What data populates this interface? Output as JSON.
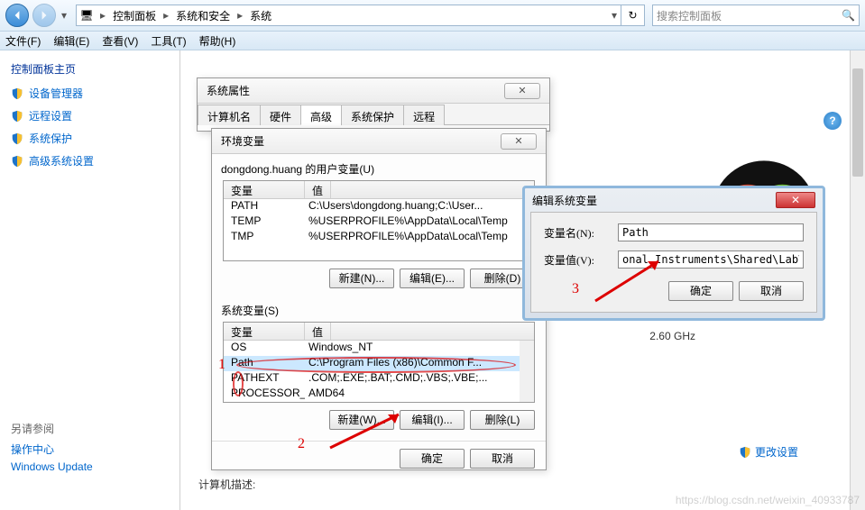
{
  "toolbar": {
    "breadcrumb": [
      "控制面板",
      "系统和安全",
      "系统"
    ],
    "search_placeholder": "搜索控制面板"
  },
  "menubar": [
    "文件(F)",
    "编辑(E)",
    "查看(V)",
    "工具(T)",
    "帮助(H)"
  ],
  "sidebar": {
    "title": "控制面板主页",
    "items": [
      "设备管理器",
      "远程设置",
      "系统保护",
      "高级系统设置"
    ],
    "footer_label": "另请参阅",
    "footers": [
      "操作中心",
      "Windows Update"
    ]
  },
  "main": {
    "ghz": "2.60 GHz",
    "change_settings": "更改设置",
    "desc_label": "计算机描述:"
  },
  "sysprops": {
    "title": "系统属性",
    "tabs": [
      "计算机名",
      "硬件",
      "高级",
      "系统保护",
      "远程"
    ]
  },
  "env": {
    "title": "环境变量",
    "user_label": "dongdong.huang 的用户变量(U)",
    "sys_label": "系统变量(S)",
    "cols": {
      "var": "变量",
      "val": "值"
    },
    "user_rows": [
      {
        "name": "PATH",
        "val": "C:\\Users\\dongdong.huang;C:\\User..."
      },
      {
        "name": "TEMP",
        "val": "%USERPROFILE%\\AppData\\Local\\Temp"
      },
      {
        "name": "TMP",
        "val": "%USERPROFILE%\\AppData\\Local\\Temp"
      }
    ],
    "sys_rows": [
      {
        "name": "OS",
        "val": "Windows_NT"
      },
      {
        "name": "Path",
        "val": "C:\\Program Files (x86)\\Common F..."
      },
      {
        "name": "PATHEXT",
        "val": ".COM;.EXE;.BAT;.CMD;.VBS;.VBE;..."
      },
      {
        "name": "PROCESSOR_AR...",
        "val": "AMD64"
      }
    ],
    "btn_new_u": "新建(N)...",
    "btn_edit_u": "编辑(E)...",
    "btn_del_u": "删除(D)",
    "btn_new_s": "新建(W)...",
    "btn_edit_s": "编辑(I)...",
    "btn_del_s": "删除(L)",
    "ok": "确定",
    "cancel": "取消"
  },
  "edit": {
    "title": "编辑系统变量",
    "name_label": "变量名(N):",
    "val_label": "变量值(V):",
    "name_val": "Path",
    "val_val": "onal Instruments\\Shared\\LabVIEW CLI",
    "ok": "确定",
    "cancel": "取消"
  },
  "annotations": {
    "a1": "1",
    "a2": "2",
    "a3": "3"
  },
  "watermark": "https://blog.csdn.net/weixin_40933787"
}
